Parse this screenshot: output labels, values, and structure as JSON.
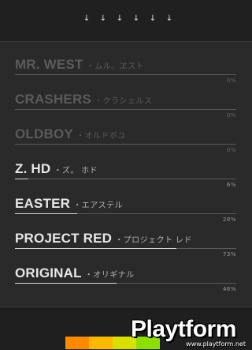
{
  "arrow_icon_count": 6,
  "arrows": [
    "↓",
    "↓",
    "↓",
    "↓",
    "↓",
    "↓"
  ],
  "items": [
    {
      "title": "MR. WEST",
      "subtitle": "・ムル。ヱスト",
      "percent": "0%",
      "progress": 0,
      "state": "dim"
    },
    {
      "title": "CRASHERS",
      "subtitle": "・クラシェルス",
      "percent": "0%",
      "progress": 0,
      "state": "dim"
    },
    {
      "title": "OLDBOY",
      "subtitle": "・オルドボユ",
      "percent": "0%",
      "progress": 0,
      "state": "dim"
    },
    {
      "title": "Z. HD",
      "subtitle": "・ズ。 ホド",
      "percent": "6%",
      "progress": 0.06,
      "state": "active"
    },
    {
      "title": "EASTER",
      "subtitle": "・エアステル",
      "percent": "28%",
      "progress": 0.28,
      "state": "active"
    },
    {
      "title": "PROJECT RED",
      "subtitle": "・プロジェクト レド",
      "percent": "73%",
      "progress": 0.73,
      "state": "active"
    },
    {
      "title": "ORIGINAL",
      "subtitle": "・オリギナル",
      "percent": "46%",
      "progress": 0.46,
      "state": "active"
    }
  ],
  "color_strip": [
    "#ff8a00",
    "#ffb800",
    "#d8e000",
    "#8ce000"
  ],
  "watermark": {
    "text": "Playtform",
    "url": "www.playtform.net"
  }
}
